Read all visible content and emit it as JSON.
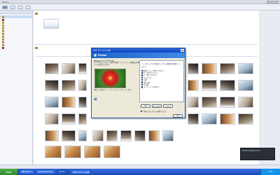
{
  "app": {
    "title": "Picasa",
    "icons": {
      "window_buttons": [
        "minimize-icon",
        "maximize-icon",
        "close-icon"
      ]
    }
  },
  "dialog": {
    "title": "Web アルバムへ公開",
    "banner": "Picasa",
    "heading": "Picasa ウェブ アルバム",
    "description": "アルバムのアップロード設定を選択してください。公開範囲と画像サイズを指定できます。",
    "note": "選択した写真をウェブ アルバムにアップロードします。",
    "links": "詳細",
    "options_title": "アップロードする写真のサイズと公開設定を選択してください",
    "options": [
      {
        "label": "推奨サイズ（1600 ピクセル）",
        "checked": true
      },
      {
        "label": "中（1024 ピクセル）",
        "checked": true
      },
      {
        "label": "小（640 ピクセル）",
        "checked": false
      },
      {
        "label": "元のサイズ",
        "checked": false
      },
      {
        "label": "公開",
        "checked": false
      },
      {
        "label": "限定公開",
        "checked": false
      },
      {
        "label": "非公開",
        "checked": false
      },
      {
        "label": "キャプションを含める",
        "checked": false
      }
    ],
    "buttons": [
      "OK",
      "キャンセル",
      "ヘルプ"
    ],
    "bottom_checkbox": "今後このメッセージを表示しない",
    "ok_label": "OK",
    "close_label": "×"
  },
  "taskbar": {
    "start": "start",
    "tasks": [
      "BBS Sec-Ri...",
      "Link Pane Sec-Ri...",
      "Picasa 3",
      "Web アルバムへ公開"
    ],
    "tray": "0:03"
  },
  "notify": {
    "text": "Picasa 3\nBackground..."
  }
}
